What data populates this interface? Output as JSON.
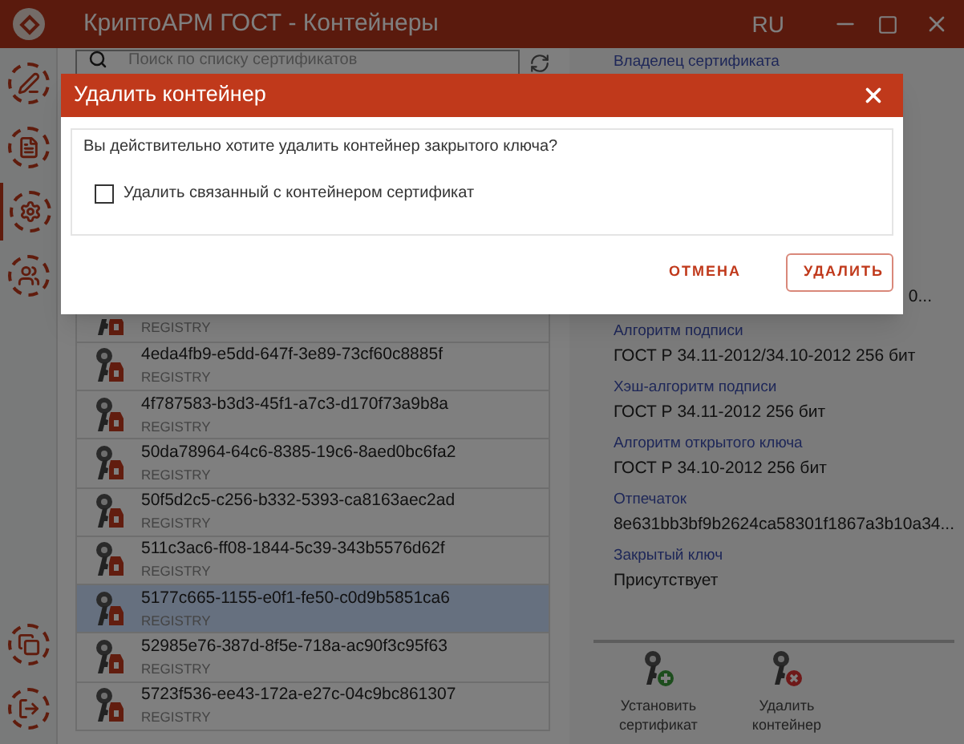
{
  "window": {
    "title": "КриптоАРМ ГОСТ - Контейнеры",
    "language": "RU"
  },
  "sidebar": {
    "items": [
      {
        "selected": false
      },
      {
        "selected": false
      },
      {
        "selected": true
      },
      {
        "selected": false
      }
    ]
  },
  "search": {
    "placeholder": "Поиск по списку сертификатов"
  },
  "containers": [
    {
      "storage": "REGISTRY",
      "selected": false
    },
    {
      "name": "4eda4fb9-e5dd-647f-3e89-73cf60c8885f",
      "storage": "REGISTRY",
      "selected": false
    },
    {
      "name": "4f787583-b3d3-45f1-a7c3-d170f73a9b8a",
      "storage": "REGISTRY",
      "selected": false
    },
    {
      "name": "50da78964-64c6-8385-19c6-8aed0bc6fa2",
      "storage": "REGISTRY",
      "selected": false
    },
    {
      "name": "50f5d2c5-c256-b332-5393-ca8163aec2ad",
      "storage": "REGISTRY",
      "selected": false
    },
    {
      "name": "511c3ac6-ff08-1844-5c39-343b5576d62f",
      "storage": "REGISTRY",
      "selected": false
    },
    {
      "name": "5177c665-1155-e0f1-fe50-c0d9b5851ca6",
      "storage": "REGISTRY",
      "selected": true
    },
    {
      "name": "52985e76-387d-8f5e-718a-ac90f3c95f63",
      "storage": "REGISTRY",
      "selected": false
    },
    {
      "name": "5723f536-ee43-172a-e27c-04c9bc861307",
      "storage": "REGISTRY",
      "selected": false
    }
  ],
  "details": {
    "owner_label": "Владелец сертификата",
    "partial_value": "0...",
    "fields": [
      {
        "label": "Алгоритм подписи",
        "value": "ГОСТ Р 34.11-2012/34.10-2012 256 бит"
      },
      {
        "label": "Хэш-алгоритм подписи",
        "value": "ГОСТ Р 34.11-2012 256 бит"
      },
      {
        "label": "Алгоритм открытого ключа",
        "value": "ГОСТ Р 34.10-2012 256 бит"
      },
      {
        "label": "Отпечаток",
        "value": "8e631bb3bf9b2624ca58301f1867a3b10a34..."
      },
      {
        "label": "Закрытый ключ",
        "value": "Присутствует"
      }
    ]
  },
  "actions": [
    {
      "kind": "install",
      "label": "Установить сертификат"
    },
    {
      "kind": "delete",
      "label": "Удалить контейнер"
    }
  ],
  "dialog": {
    "title": "Удалить контейнер",
    "message": "Вы действительно хотите удалить контейнер закрытого ключа?",
    "checkbox": {
      "label": "Удалить связанный с контейнером сертификат",
      "checked": false
    },
    "buttons": [
      {
        "kind": "text",
        "label": "ОТМЕНА"
      },
      {
        "kind": "outlined",
        "label": "УДАЛИТЬ"
      }
    ]
  }
}
